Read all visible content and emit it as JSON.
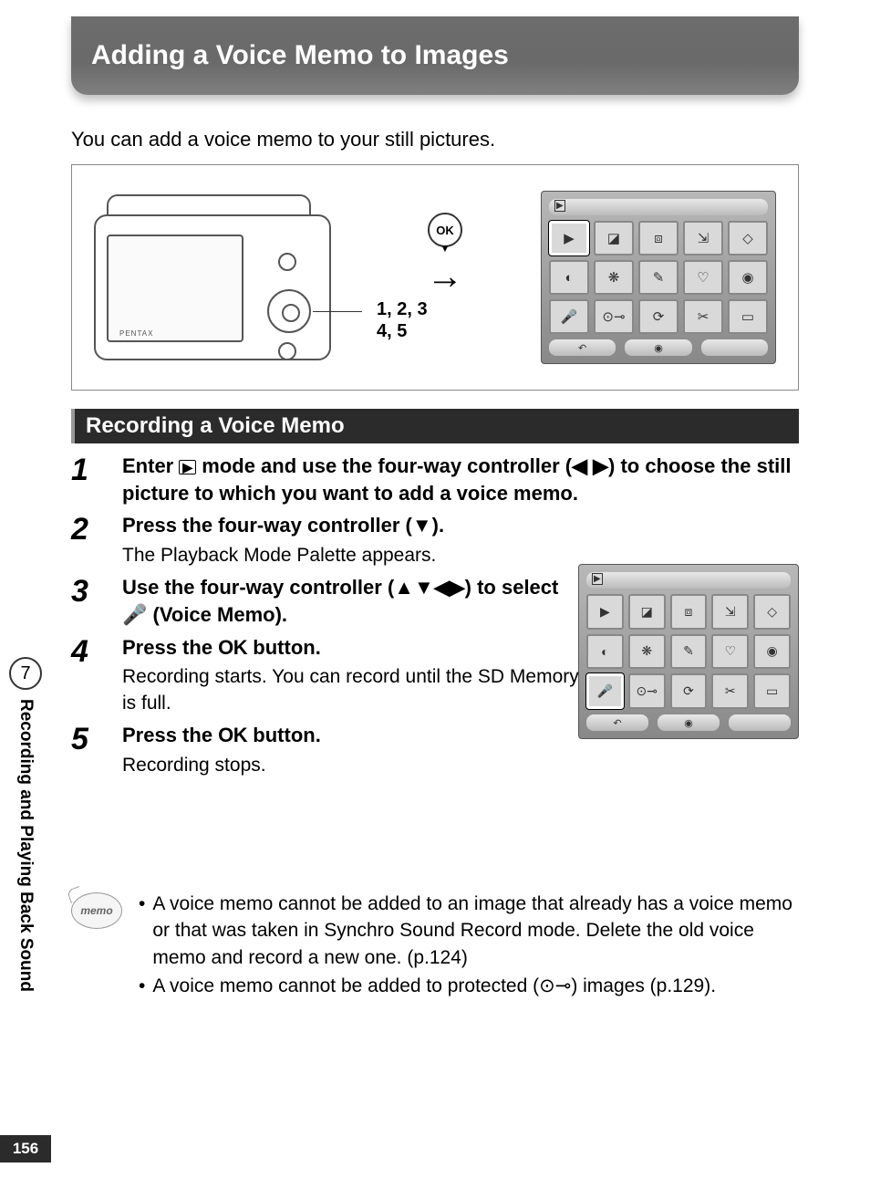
{
  "title": "Adding a Voice Memo to Images",
  "intro": "You can add a voice memo to your still pictures.",
  "diagram": {
    "ok_label": "OK",
    "step_labels_line1": "1, 2, 3",
    "step_labels_line2": "4, 5",
    "camera_brand": "PENTAX"
  },
  "section_heading": "Recording a Voice Memo",
  "steps": [
    {
      "num": "1",
      "head_pre": "Enter ",
      "head_mid": " mode and use the four-way controller (◀ ▶) to choose the still picture to which you want to add a voice memo.",
      "play_icon": "▶"
    },
    {
      "num": "2",
      "head": "Press the four-way controller (▼).",
      "sub": "The Playback Mode Palette appears."
    },
    {
      "num": "3",
      "head_pre": "Use the four-way controller (▲▼◀▶) to select ",
      "head_post": " (Voice Memo).",
      "mic_icon": "🎤"
    },
    {
      "num": "4",
      "head_pre": "Press the ",
      "ok": "OK",
      "head_post": " button.",
      "sub": "Recording starts. You can record until the SD Memory Card or built-in memory is full."
    },
    {
      "num": "5",
      "head_pre": "Press the ",
      "ok": "OK",
      "head_post": " button.",
      "sub": "Recording stops."
    }
  ],
  "memo": {
    "badge": "memo",
    "bullets": [
      "A voice memo cannot be added to an image that already has a voice memo or that was taken in Synchro Sound Record mode. Delete the old voice memo and record a new one. (p.124)",
      "A voice memo cannot be added to protected (⊙⊸) images (p.129)."
    ]
  },
  "sidebar": {
    "chapter_num": "7",
    "chapter_label": "Recording and Playing Back Sound"
  },
  "page_number": "156",
  "palette_icons": [
    "▶",
    "◪",
    "⧈",
    "⇲",
    "◇",
    "◐",
    "❋",
    "✎",
    "♡",
    "◉",
    "🎤",
    "⊙⊸",
    "⟳",
    "✂",
    "▭"
  ],
  "palette_bottom": [
    "↶",
    "◉",
    ""
  ]
}
